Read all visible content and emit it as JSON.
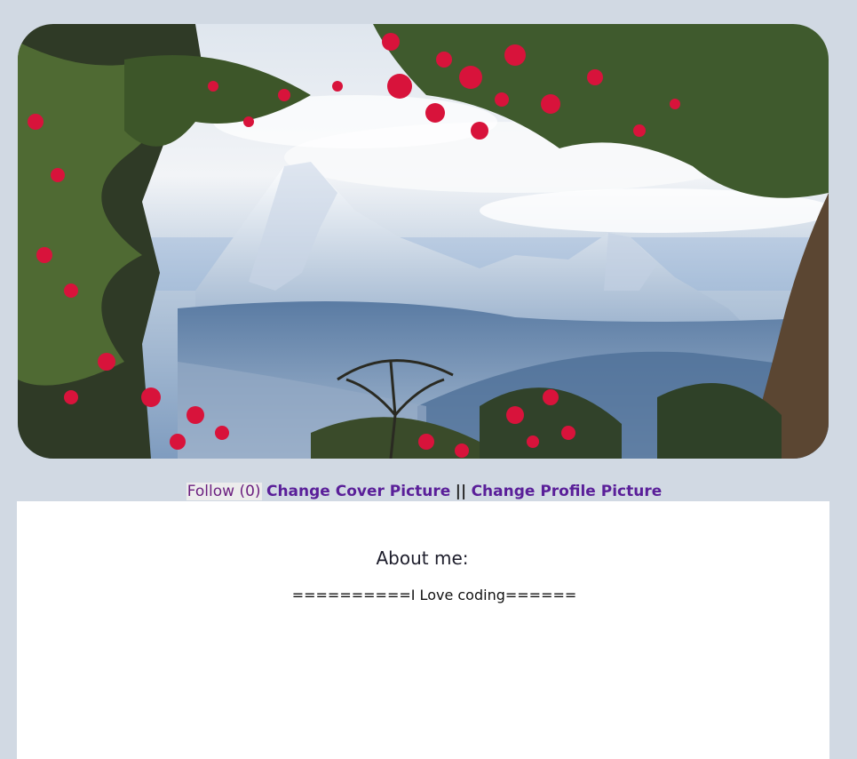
{
  "actions": {
    "follow_label": "Follow",
    "follow_count": "(0)",
    "change_cover_label": "Change Cover Picture",
    "separator": "||",
    "change_profile_label": "Change Profile Picture"
  },
  "about": {
    "heading": "About me:",
    "text": "==========I Love coding======"
  },
  "colors": {
    "page_background": "#d1d9e3",
    "link": "#5a1f99",
    "follow": "#6b1f7f",
    "panel": "#ffffff"
  }
}
